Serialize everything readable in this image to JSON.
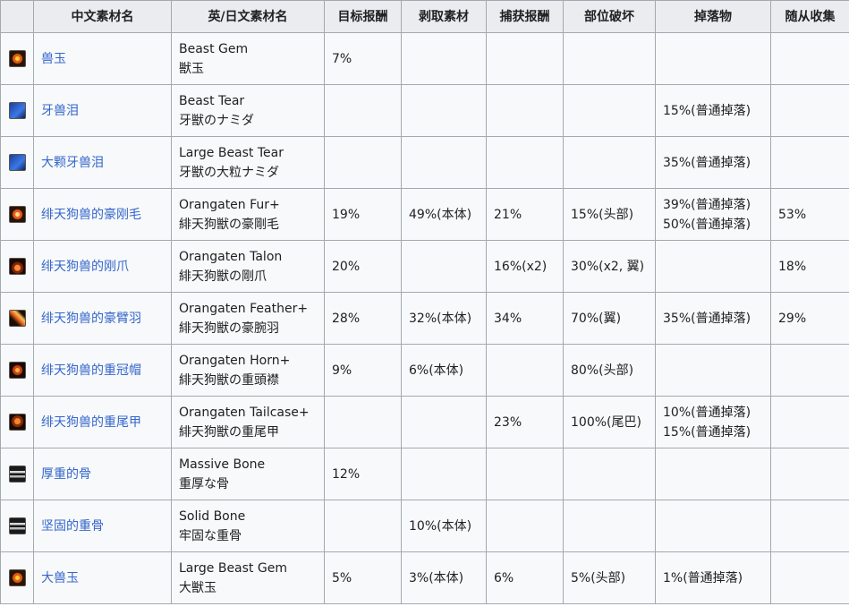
{
  "headers": [
    "",
    "中文素材名",
    "英/日文素材名",
    "目标报酬",
    "剥取素材",
    "捕获报酬",
    "部位破坏",
    "掉落物",
    "随从收集"
  ],
  "rows": [
    {
      "icon": "gem-icon",
      "icon_class": "gem",
      "cn": "兽玉",
      "en": "Beast Gem",
      "jp": "獣玉",
      "target": "7%",
      "carve": "",
      "capture": "",
      "break": "",
      "drop": [],
      "palico": ""
    },
    {
      "icon": "tear-icon",
      "icon_class": "tear",
      "cn": "牙兽泪",
      "en": "Beast Tear",
      "jp": "牙獣のナミダ",
      "target": "",
      "carve": "",
      "capture": "",
      "break": "",
      "drop": [
        "15%(普通掉落)"
      ],
      "palico": ""
    },
    {
      "icon": "tear-icon",
      "icon_class": "tear",
      "cn": "大颗牙兽泪",
      "en": "Large Beast Tear",
      "jp": "牙獣の大粒ナミダ",
      "target": "",
      "carve": "",
      "capture": "",
      "break": "",
      "drop": [
        "35%(普通掉落)"
      ],
      "palico": ""
    },
    {
      "icon": "fur-icon",
      "icon_class": "fur",
      "cn": "绯天狗兽的豪刚毛",
      "en": "Orangaten Fur+",
      "jp": "緋天狗獣の豪剛毛",
      "target": "19%",
      "carve": "49%(本体)",
      "capture": "21%",
      "break": "15%(头部)",
      "drop": [
        "39%(普通掉落)",
        "50%(普通掉落)"
      ],
      "palico": "53%"
    },
    {
      "icon": "claw-icon",
      "icon_class": "claw",
      "cn": "绯天狗兽的刚爪",
      "en": "Orangaten Talon",
      "jp": "緋天狗獣の剛爪",
      "target": "20%",
      "carve": "",
      "capture": "16%(x2)",
      "break": "30%(x2, 翼)",
      "drop": [],
      "palico": "18%"
    },
    {
      "icon": "feather-icon",
      "icon_class": "feather",
      "cn": "绯天狗兽的豪臂羽",
      "en": "Orangaten Feather+",
      "jp": "緋天狗獣の豪腕羽",
      "target": "28%",
      "carve": "32%(本体)",
      "capture": "34%",
      "break": "70%(翼)",
      "drop": [
        "35%(普通掉落)"
      ],
      "palico": "29%"
    },
    {
      "icon": "horn-icon",
      "icon_class": "horn",
      "cn": "绯天狗兽的重冠帽",
      "en": "Orangaten Horn+",
      "jp": "緋天狗獣の重頭襟",
      "target": "9%",
      "carve": "6%(本体)",
      "capture": "",
      "break": "80%(头部)",
      "drop": [],
      "palico": ""
    },
    {
      "icon": "tailcase-icon",
      "icon_class": "tail",
      "cn": "绯天狗兽的重尾甲",
      "en": "Orangaten Tailcase+",
      "jp": "緋天狗獣の重尾甲",
      "target": "",
      "carve": "",
      "capture": "23%",
      "break": "100%(尾巴)",
      "drop": [
        "10%(普通掉落)",
        "15%(普通掉落)"
      ],
      "palico": ""
    },
    {
      "icon": "bone-icon",
      "icon_class": "bone",
      "cn": "厚重的骨",
      "en": "Massive Bone",
      "jp": "重厚な骨",
      "target": "12%",
      "carve": "",
      "capture": "",
      "break": "",
      "drop": [],
      "palico": ""
    },
    {
      "icon": "bone-icon",
      "icon_class": "bone",
      "cn": "坚固的重骨",
      "en": "Solid Bone",
      "jp": "牢固な重骨",
      "target": "",
      "carve": "10%(本体)",
      "capture": "",
      "break": "",
      "drop": [],
      "palico": ""
    },
    {
      "icon": "gem-icon",
      "icon_class": "gem",
      "cn": "大兽玉",
      "en": "Large Beast Gem",
      "jp": "大獣玉",
      "target": "5%",
      "carve": "3%(本体)",
      "capture": "6%",
      "break": "5%(头部)",
      "drop": [
        "1%(普通掉落)"
      ],
      "palico": ""
    }
  ]
}
